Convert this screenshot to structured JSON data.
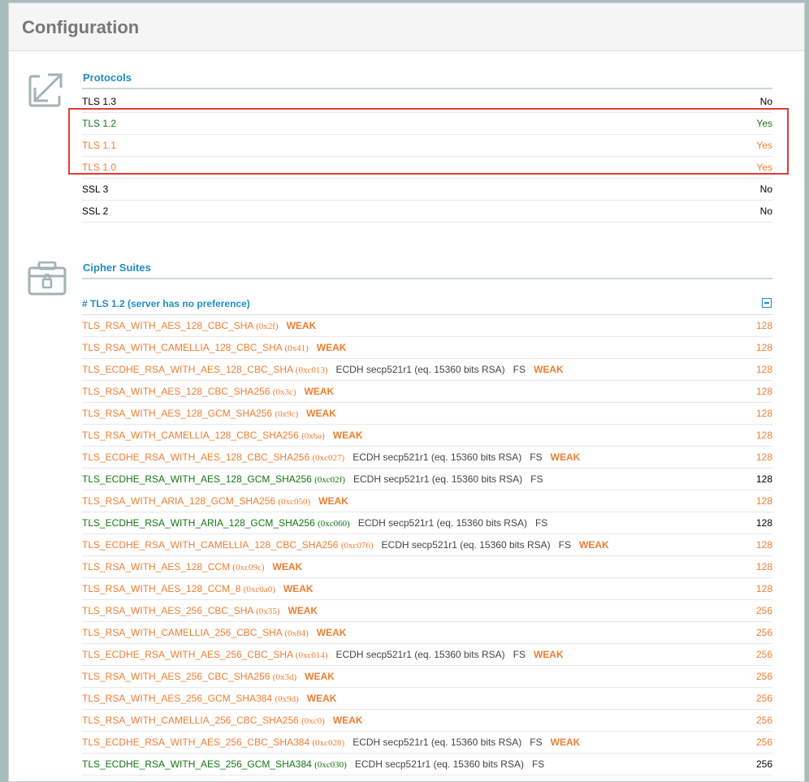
{
  "header": {
    "title": "Configuration"
  },
  "protocols": {
    "title": "Protocols",
    "items": [
      {
        "name": "TLS 1.3",
        "value": "No",
        "status": "black"
      },
      {
        "name": "TLS 1.2",
        "value": "Yes",
        "status": "green"
      },
      {
        "name": "TLS 1.1",
        "value": "Yes",
        "status": "orange"
      },
      {
        "name": "TLS 1.0",
        "value": "Yes",
        "status": "orange"
      },
      {
        "name": "SSL 3",
        "value": "No",
        "status": "black"
      },
      {
        "name": "SSL 2",
        "value": "No",
        "status": "black"
      }
    ]
  },
  "ciphers": {
    "title": "Cipher Suites",
    "group_label": "# TLS 1.2 (server has no preference)",
    "rows": [
      {
        "name": "TLS_RSA_WITH_AES_128_CBC_SHA",
        "hex": "(0x2f)",
        "kex": "",
        "fs": "",
        "weak": "WEAK",
        "bits": "128",
        "status": "orange"
      },
      {
        "name": "TLS_RSA_WITH_CAMELLIA_128_CBC_SHA",
        "hex": "(0x41)",
        "kex": "",
        "fs": "",
        "weak": "WEAK",
        "bits": "128",
        "status": "orange"
      },
      {
        "name": "TLS_ECDHE_RSA_WITH_AES_128_CBC_SHA",
        "hex": "(0xc013)",
        "kex": "ECDH secp521r1 (eq. 15360 bits RSA)",
        "fs": "FS",
        "weak": "WEAK",
        "bits": "128",
        "status": "orange"
      },
      {
        "name": "TLS_RSA_WITH_AES_128_CBC_SHA256",
        "hex": "(0x3c)",
        "kex": "",
        "fs": "",
        "weak": "WEAK",
        "bits": "128",
        "status": "orange"
      },
      {
        "name": "TLS_RSA_WITH_AES_128_GCM_SHA256",
        "hex": "(0x9c)",
        "kex": "",
        "fs": "",
        "weak": "WEAK",
        "bits": "128",
        "status": "orange"
      },
      {
        "name": "TLS_RSA_WITH_CAMELLIA_128_CBC_SHA256",
        "hex": "(0xba)",
        "kex": "",
        "fs": "",
        "weak": "WEAK",
        "bits": "128",
        "status": "orange"
      },
      {
        "name": "TLS_ECDHE_RSA_WITH_AES_128_CBC_SHA256",
        "hex": "(0xc027)",
        "kex": "ECDH secp521r1 (eq. 15360 bits RSA)",
        "fs": "FS",
        "weak": "WEAK",
        "bits": "128",
        "status": "orange"
      },
      {
        "name": "TLS_ECDHE_RSA_WITH_AES_128_GCM_SHA256",
        "hex": "(0xc02f)",
        "kex": "ECDH secp521r1 (eq. 15360 bits RSA)",
        "fs": "FS",
        "weak": "",
        "bits": "128",
        "status": "green"
      },
      {
        "name": "TLS_RSA_WITH_ARIA_128_GCM_SHA256",
        "hex": "(0xc050)",
        "kex": "",
        "fs": "",
        "weak": "WEAK",
        "bits": "128",
        "status": "orange"
      },
      {
        "name": "TLS_ECDHE_RSA_WITH_ARIA_128_GCM_SHA256",
        "hex": "(0xc060)",
        "kex": "ECDH secp521r1 (eq. 15360 bits RSA)",
        "fs": "FS",
        "weak": "",
        "bits": "128",
        "status": "green"
      },
      {
        "name": "TLS_ECDHE_RSA_WITH_CAMELLIA_128_CBC_SHA256",
        "hex": "(0xc076)",
        "kex": "ECDH secp521r1 (eq. 15360 bits RSA)",
        "fs": "FS",
        "weak": "WEAK",
        "bits": "128",
        "status": "orange"
      },
      {
        "name": "TLS_RSA_WITH_AES_128_CCM",
        "hex": "(0xc09c)",
        "kex": "",
        "fs": "",
        "weak": "WEAK",
        "bits": "128",
        "status": "orange"
      },
      {
        "name": "TLS_RSA_WITH_AES_128_CCM_8",
        "hex": "(0xc0a0)",
        "kex": "",
        "fs": "",
        "weak": "WEAK",
        "bits": "128",
        "status": "orange"
      },
      {
        "name": "TLS_RSA_WITH_AES_256_CBC_SHA",
        "hex": "(0x35)",
        "kex": "",
        "fs": "",
        "weak": "WEAK",
        "bits": "256",
        "status": "orange"
      },
      {
        "name": "TLS_RSA_WITH_CAMELLIA_256_CBC_SHA",
        "hex": "(0x84)",
        "kex": "",
        "fs": "",
        "weak": "WEAK",
        "bits": "256",
        "status": "orange"
      },
      {
        "name": "TLS_ECDHE_RSA_WITH_AES_256_CBC_SHA",
        "hex": "(0xc014)",
        "kex": "ECDH secp521r1 (eq. 15360 bits RSA)",
        "fs": "FS",
        "weak": "WEAK",
        "bits": "256",
        "status": "orange"
      },
      {
        "name": "TLS_RSA_WITH_AES_256_CBC_SHA256",
        "hex": "(0x3d)",
        "kex": "",
        "fs": "",
        "weak": "WEAK",
        "bits": "256",
        "status": "orange"
      },
      {
        "name": "TLS_RSA_WITH_AES_256_GCM_SHA384",
        "hex": "(0x9d)",
        "kex": "",
        "fs": "",
        "weak": "WEAK",
        "bits": "256",
        "status": "orange"
      },
      {
        "name": "TLS_RSA_WITH_CAMELLIA_256_CBC_SHA256",
        "hex": "(0xc0)",
        "kex": "",
        "fs": "",
        "weak": "WEAK",
        "bits": "256",
        "status": "orange"
      },
      {
        "name": "TLS_ECDHE_RSA_WITH_AES_256_CBC_SHA384",
        "hex": "(0xc028)",
        "kex": "ECDH secp521r1 (eq. 15360 bits RSA)",
        "fs": "FS",
        "weak": "WEAK",
        "bits": "256",
        "status": "orange"
      },
      {
        "name": "TLS_ECDHE_RSA_WITH_AES_256_GCM_SHA384",
        "hex": "(0xc030)",
        "kex": "ECDH secp521r1 (eq. 15360 bits RSA)",
        "fs": "FS",
        "weak": "",
        "bits": "256",
        "status": "green"
      }
    ]
  },
  "icons": {
    "protocols": "expand-arrows-icon",
    "ciphers": "toolbox-lock-icon",
    "collapse": "collapse-minus-icon"
  },
  "colors": {
    "accent_blue": "#1e8ec4",
    "ok_green": "#117711",
    "warn_orange": "#f07d30",
    "highlight_red": "#e53935"
  }
}
